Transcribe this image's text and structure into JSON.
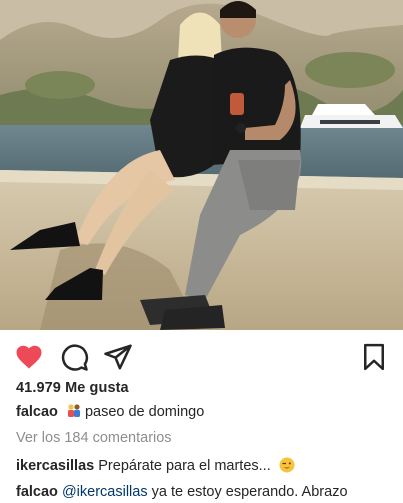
{
  "post": {
    "likes": "41.979 Me gusta",
    "caption": {
      "username": "falcao",
      "emoji": "couple-emoji",
      "text": "paseo de domingo"
    },
    "view_comments": "Ver los 184 comentarios",
    "comments": [
      {
        "username": "ikercasillas",
        "text": "Prepárate para el martes...",
        "emoji": "winking-face-emoji"
      },
      {
        "username": "falcao",
        "mention": "@ikercasillas",
        "text": "ya te estoy esperando. Abrazo"
      }
    ]
  },
  "icons": {
    "like": "heart-icon",
    "comment": "comment-bubble-icon",
    "share": "paper-plane-icon",
    "save": "bookmark-icon"
  },
  "colors": {
    "like_active": "#ed4956",
    "text": "#262626",
    "muted": "#8e8e8e",
    "mention": "#00376b"
  }
}
